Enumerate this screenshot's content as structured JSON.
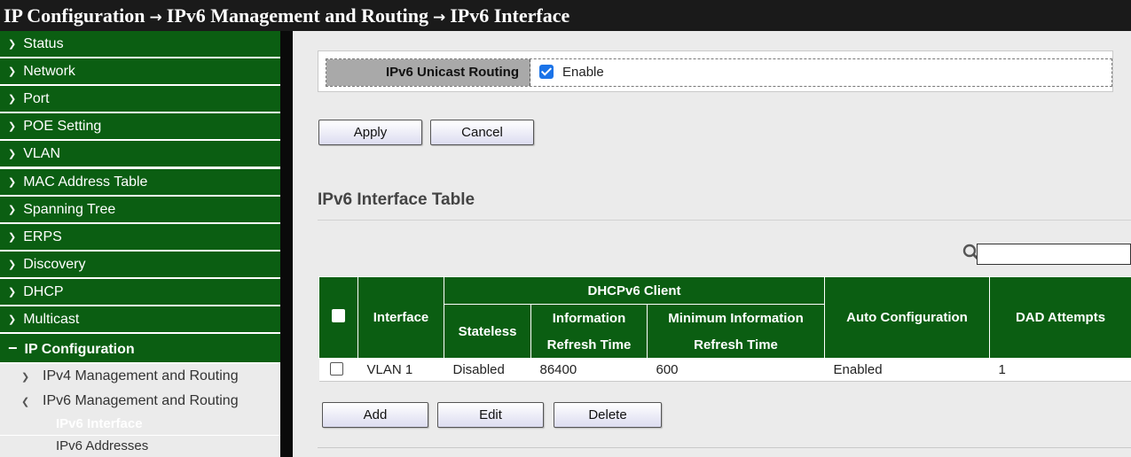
{
  "breadcrumb": {
    "part1": "IP Configuration",
    "part2": "IPv6 Management and Routing",
    "part3": "IPv6 Interface",
    "separator": "→"
  },
  "sidebar": {
    "items": [
      {
        "label": "Status"
      },
      {
        "label": "Network"
      },
      {
        "label": "Port"
      },
      {
        "label": "POE Setting"
      },
      {
        "label": "VLAN"
      },
      {
        "label": "MAC Address Table"
      },
      {
        "label": "Spanning Tree"
      },
      {
        "label": "ERPS"
      },
      {
        "label": "Discovery"
      },
      {
        "label": "DHCP"
      },
      {
        "label": "Multicast"
      },
      {
        "label": "IP Configuration"
      }
    ],
    "sub_items": [
      {
        "label": "IPv4 Management and Routing"
      },
      {
        "label": "IPv6 Management and Routing"
      }
    ],
    "leaf_items": [
      {
        "label": "IPv6 Interface"
      },
      {
        "label": "IPv6 Addresses"
      }
    ]
  },
  "routing": {
    "label": "IPv6 Unicast Routing",
    "checkbox_label": "Enable",
    "checked": true
  },
  "buttons": {
    "apply": "Apply",
    "cancel": "Cancel",
    "add": "Add",
    "edit": "Edit",
    "delete": "Delete"
  },
  "table": {
    "title": "IPv6 Interface Table",
    "search_value": "",
    "headers": {
      "interface": "Interface",
      "dhcp_group": "DHCPv6 Client",
      "stateless": "Stateless",
      "info_refresh_l1": "Information",
      "info_refresh_l2": "Refresh Time",
      "min_info_l1": "Minimum Information",
      "min_info_l2": "Refresh Time",
      "auto_config": "Auto Configuration",
      "dad": "DAD Attempts"
    },
    "rows": [
      {
        "interface": "VLAN 1",
        "stateless": "Disabled",
        "info_refresh": "86400",
        "min_info_refresh": "600",
        "auto_config": "Enabled",
        "dad": "1"
      }
    ]
  },
  "colors": {
    "menu_green": "#0b5e12",
    "title_bg": "#1a1a1a",
    "page_bg": "#ebebeb",
    "checkbox_blue": "#1a73e8"
  }
}
